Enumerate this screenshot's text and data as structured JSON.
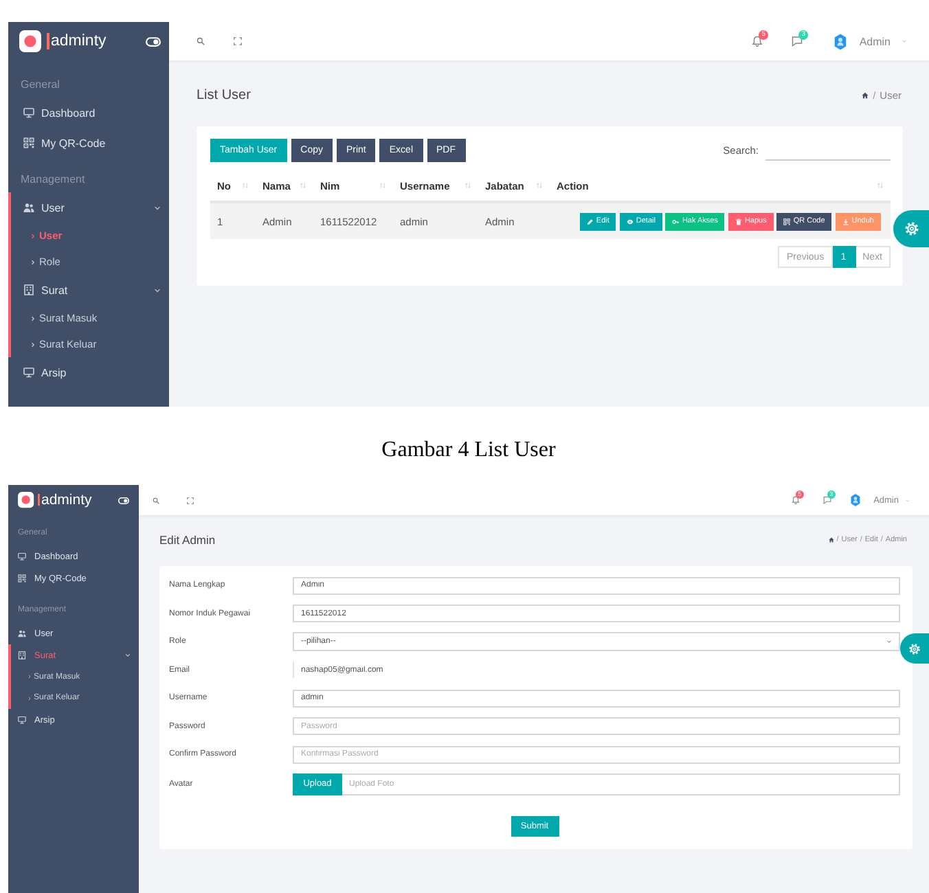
{
  "list_screen": {
    "sidebar": {
      "brand": "adminty",
      "sections": [
        {
          "title": "General",
          "items": [
            {
              "label": "Dashboard",
              "selected": false,
              "expanded": false
            },
            {
              "label": "My QR-Code",
              "selected": false,
              "expanded": false
            }
          ]
        },
        {
          "title": "Management",
          "items": [
            {
              "label": "User",
              "selected": false,
              "expanded": true,
              "children": [
                {
                  "label": "User",
                  "selected": true
                },
                {
                  "label": "Role",
                  "selected": false
                }
              ]
            },
            {
              "label": "Surat",
              "selected": false,
              "expanded": true,
              "children": [
                {
                  "label": "Surat Masuk",
                  "selected": false
                },
                {
                  "label": "Surat Keluar",
                  "selected": false
                }
              ]
            },
            {
              "label": "Arsip",
              "selected": false,
              "expanded": false
            }
          ]
        }
      ]
    },
    "header": {
      "notifications": [
        {
          "count": "5",
          "color": "#fe5d70"
        },
        {
          "count": "3",
          "color": "#2ed8b6"
        }
      ],
      "user": "Admin"
    },
    "page": {
      "title": "List User",
      "breadcrumb": {
        "separator": "/",
        "items": [
          "User"
        ]
      }
    },
    "toolbar": {
      "buttons": [
        {
          "label": "Tambah User",
          "kind": "primary"
        },
        {
          "label": "Copy",
          "kind": "secondary"
        },
        {
          "label": "Print",
          "kind": "secondary"
        },
        {
          "label": "Excel",
          "kind": "secondary"
        },
        {
          "label": "PDF",
          "kind": "secondary"
        }
      ],
      "search_label": "Search:"
    },
    "table": {
      "columns": [
        "No",
        "Nama",
        "Nim",
        "Username",
        "Jabatan",
        "Action"
      ],
      "rows": [
        {
          "cells": [
            "1",
            "Admin",
            "1611522012",
            "admin",
            "Admin"
          ],
          "actions": [
            {
              "label": "Edit",
              "color": "#01a9ac"
            },
            {
              "label": "Detail",
              "color": "#01a9ac"
            },
            {
              "label": "Hak Akses",
              "color": "#0ac282"
            },
            {
              "label": "Hapus",
              "color": "#fe5d70"
            },
            {
              "label": "QR Code",
              "color": "#404e67"
            },
            {
              "label": "Unduh",
              "color": "#fe9365"
            }
          ]
        }
      ]
    },
    "pagination": [
      {
        "label": "Previous",
        "selected": false
      },
      {
        "label": "1",
        "selected": true
      },
      {
        "label": "Next",
        "selected": false
      }
    ]
  },
  "caption": "Gambar 4 List User",
  "edit_screen": {
    "sidebar": {
      "brand": "adminty",
      "sections": [
        {
          "title": "General",
          "items": [
            {
              "label": "Dashboard",
              "selected": false,
              "expanded": false
            },
            {
              "label": "My QR-Code",
              "selected": false,
              "expanded": false
            }
          ]
        },
        {
          "title": "Management",
          "items": [
            {
              "label": "User",
              "selected": false,
              "expanded": false
            },
            {
              "label": "Surat",
              "selected": true,
              "expanded": true,
              "children": [
                {
                  "label": "Surat Masuk",
                  "selected": false
                },
                {
                  "label": "Surat Keluar",
                  "selected": false
                }
              ]
            },
            {
              "label": "Arsip",
              "selected": false,
              "expanded": false
            }
          ]
        }
      ]
    },
    "header": {
      "notifications": [
        {
          "count": "5",
          "color": "#fe5d70"
        },
        {
          "count": "3",
          "color": "#2ed8b6"
        }
      ],
      "user": "Admin"
    },
    "page": {
      "title": "Edit Admin",
      "breadcrumb": {
        "separator": "/",
        "items": [
          "User",
          "Edit",
          "Admin"
        ]
      }
    },
    "form": {
      "fields": [
        {
          "label": "Nama Lengkap",
          "kind": "text",
          "value": "Admin"
        },
        {
          "label": "Nomor Induk Pegawai",
          "kind": "text",
          "value": "1611522012"
        },
        {
          "label": "Role",
          "kind": "select",
          "value": "--pilihan--"
        },
        {
          "label": "Email",
          "kind": "plain",
          "value": "nashap05@gmail.com"
        },
        {
          "label": "Username",
          "kind": "text",
          "value": "admin"
        },
        {
          "label": "Password",
          "kind": "text",
          "placeholder": "Password"
        },
        {
          "label": "Confirm Password",
          "kind": "text",
          "placeholder": "Konfirmasi Password"
        },
        {
          "label": "Avatar",
          "kind": "file",
          "button": "Upload",
          "placeholder": "Upload Foto"
        }
      ],
      "submit": "Submit"
    }
  }
}
